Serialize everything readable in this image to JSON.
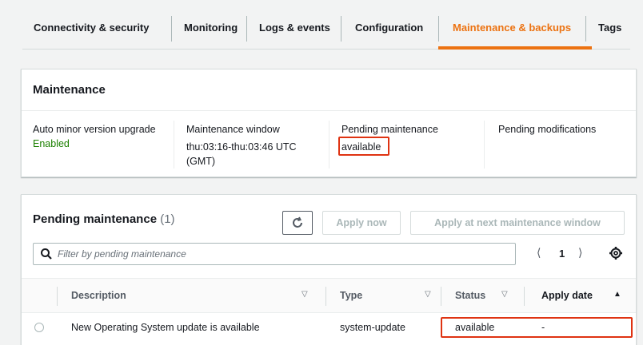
{
  "tabs": [
    {
      "label": "Connectivity & security"
    },
    {
      "label": "Monitoring"
    },
    {
      "label": "Logs & events"
    },
    {
      "label": "Configuration"
    },
    {
      "label": "Maintenance & backups",
      "active": true
    },
    {
      "label": "Tags"
    }
  ],
  "maintenance": {
    "title": "Maintenance",
    "auto_minor": {
      "label": "Auto minor version upgrade",
      "value": "Enabled"
    },
    "window": {
      "label": "Maintenance window",
      "value": "thu:03:16-thu:03:46 UTC (GMT)"
    },
    "pending": {
      "label": "Pending maintenance",
      "value": "available"
    },
    "modifications": {
      "label": "Pending modifications",
      "value": ""
    }
  },
  "pending_panel": {
    "title": "Pending maintenance",
    "count": "(1)",
    "refresh_icon": "refresh-icon",
    "apply_now": "Apply now",
    "apply_next": "Apply at next maintenance window",
    "search_placeholder": "Filter by pending maintenance",
    "page": "1",
    "columns": {
      "description": "Description",
      "type": "Type",
      "status": "Status",
      "apply_date": "Apply date"
    },
    "rows": [
      {
        "description": "New Operating System update is available",
        "type": "system-update",
        "status": "available",
        "apply_date": "-"
      }
    ]
  },
  "colors": {
    "accent": "#ec7211",
    "enabled": "#1d8102",
    "highlight": "#df3312"
  }
}
